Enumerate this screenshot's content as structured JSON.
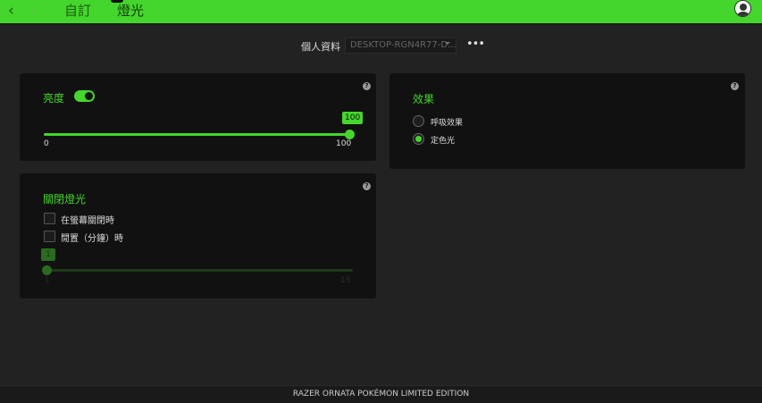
{
  "topbar": {
    "back_icon": "chevron-left",
    "forward_icon": "chevron-right",
    "tabs": [
      {
        "label": "自訂"
      },
      {
        "label": "燈光"
      }
    ]
  },
  "profile": {
    "label": "個人資料",
    "selected": "DESKTOP-RGN4R77-D...",
    "more": "•••"
  },
  "brightness": {
    "title": "亮度",
    "enabled": true,
    "value": "100",
    "min": "0",
    "max": "100",
    "percent": 100
  },
  "lights_off": {
    "title": "關閉燈光",
    "options": [
      {
        "label": "在螢幕關閉時",
        "checked": false
      },
      {
        "label": "閒置（分鐘）時",
        "checked": false
      }
    ],
    "value": "1",
    "min": "1",
    "max": "15"
  },
  "effects": {
    "title": "效果",
    "options": [
      {
        "label": "呼吸效果",
        "selected": false
      },
      {
        "label": "定色光",
        "selected": true
      }
    ]
  },
  "footer": {
    "device": "RAZER ORNATA POKÉMON LIMITED EDITION"
  },
  "colors": {
    "accent": "#44d62c"
  }
}
